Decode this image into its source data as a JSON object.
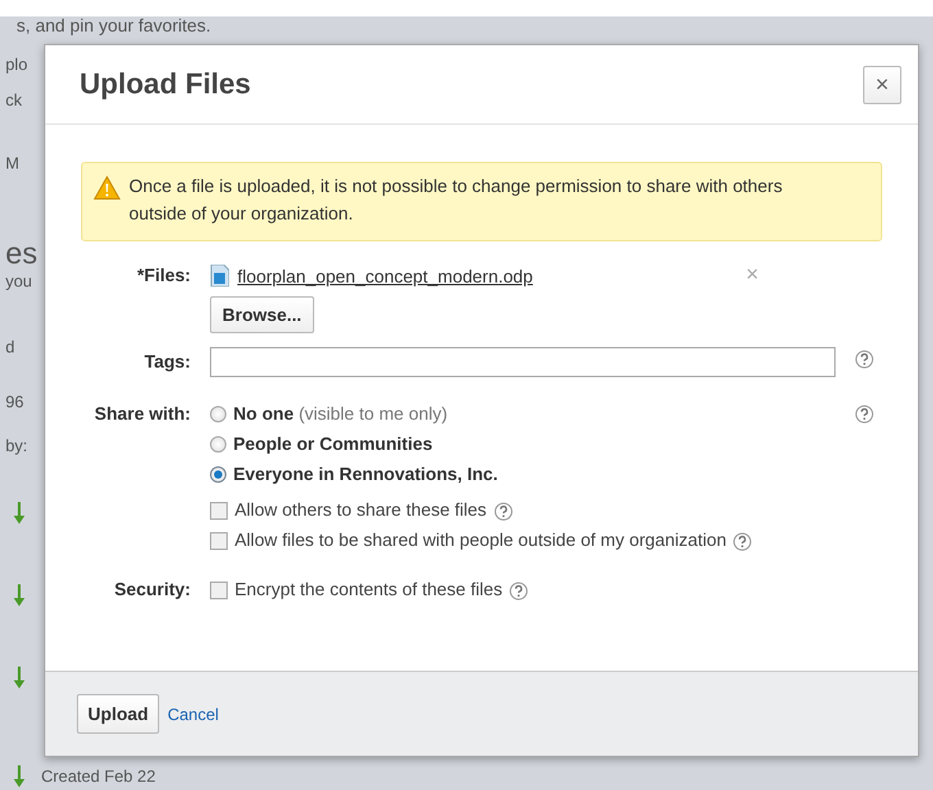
{
  "background": {
    "intro": "s, and pin your favorites.",
    "fragments": [
      "plo",
      "ck",
      "M",
      "es",
      "you",
      "d",
      "96",
      "by:"
    ],
    "created": "Created Feb 22"
  },
  "dialog": {
    "title": "Upload Files",
    "close": "×",
    "warning": "Once a file is uploaded, it is not possible to change permission to share with others outside of your organization.",
    "files_label": "*Files:",
    "file": {
      "name": "floorplan_open_concept_modern.odp",
      "remove": "×"
    },
    "browse": "Browse...",
    "tags_label": "Tags:",
    "share_label": "Share with:",
    "share_options": [
      {
        "label": "No one",
        "note": "(visible to me only)",
        "selected": false
      },
      {
        "label": "People or Communities",
        "selected": false
      },
      {
        "label": "Everyone in Rennovations, Inc.",
        "selected": true
      }
    ],
    "share_checks": [
      {
        "label": "Allow others to share these files",
        "checked": false
      },
      {
        "label": "Allow files to be shared with people outside of my organization",
        "checked": false
      }
    ],
    "security_label": "Security:",
    "security_checks": [
      {
        "label": "Encrypt the contents of these files",
        "checked": false
      }
    ],
    "upload": "Upload",
    "cancel": "Cancel"
  }
}
